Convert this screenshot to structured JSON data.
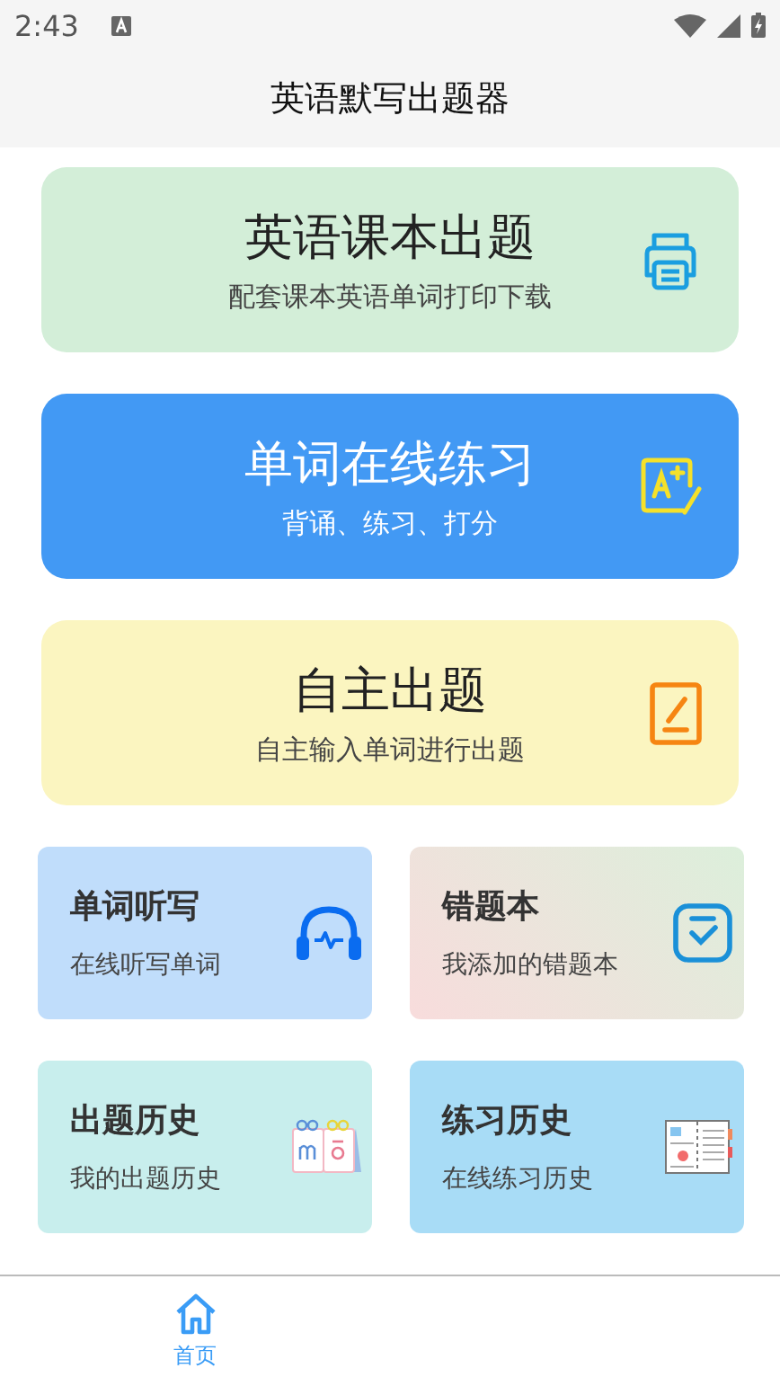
{
  "status_bar": {
    "time": "2:43"
  },
  "app_bar": {
    "title": "英语默写出题器"
  },
  "feature_cards": [
    {
      "kind": "textbook",
      "title": "英语课本出题",
      "subtitle": "配套课本英语单词打印下载"
    },
    {
      "kind": "practice",
      "title": "单词在线练习",
      "subtitle": "背诵、练习、打分"
    },
    {
      "kind": "custom",
      "title": "自主出题",
      "subtitle": "自主输入单词进行出题"
    }
  ],
  "tool_cards": [
    {
      "kind": "dictation",
      "title": "单词听写",
      "subtitle": "在线听写单词"
    },
    {
      "kind": "mistakes",
      "title": "错题本",
      "subtitle": "我添加的错题本"
    },
    {
      "kind": "quiz_history",
      "title": "出题历史",
      "subtitle": "我的出题历史"
    },
    {
      "kind": "practice_history",
      "title": "练习历史",
      "subtitle": "在线练习历史"
    }
  ],
  "bottom_nav": [
    {
      "label": "首页",
      "selected": true
    }
  ]
}
